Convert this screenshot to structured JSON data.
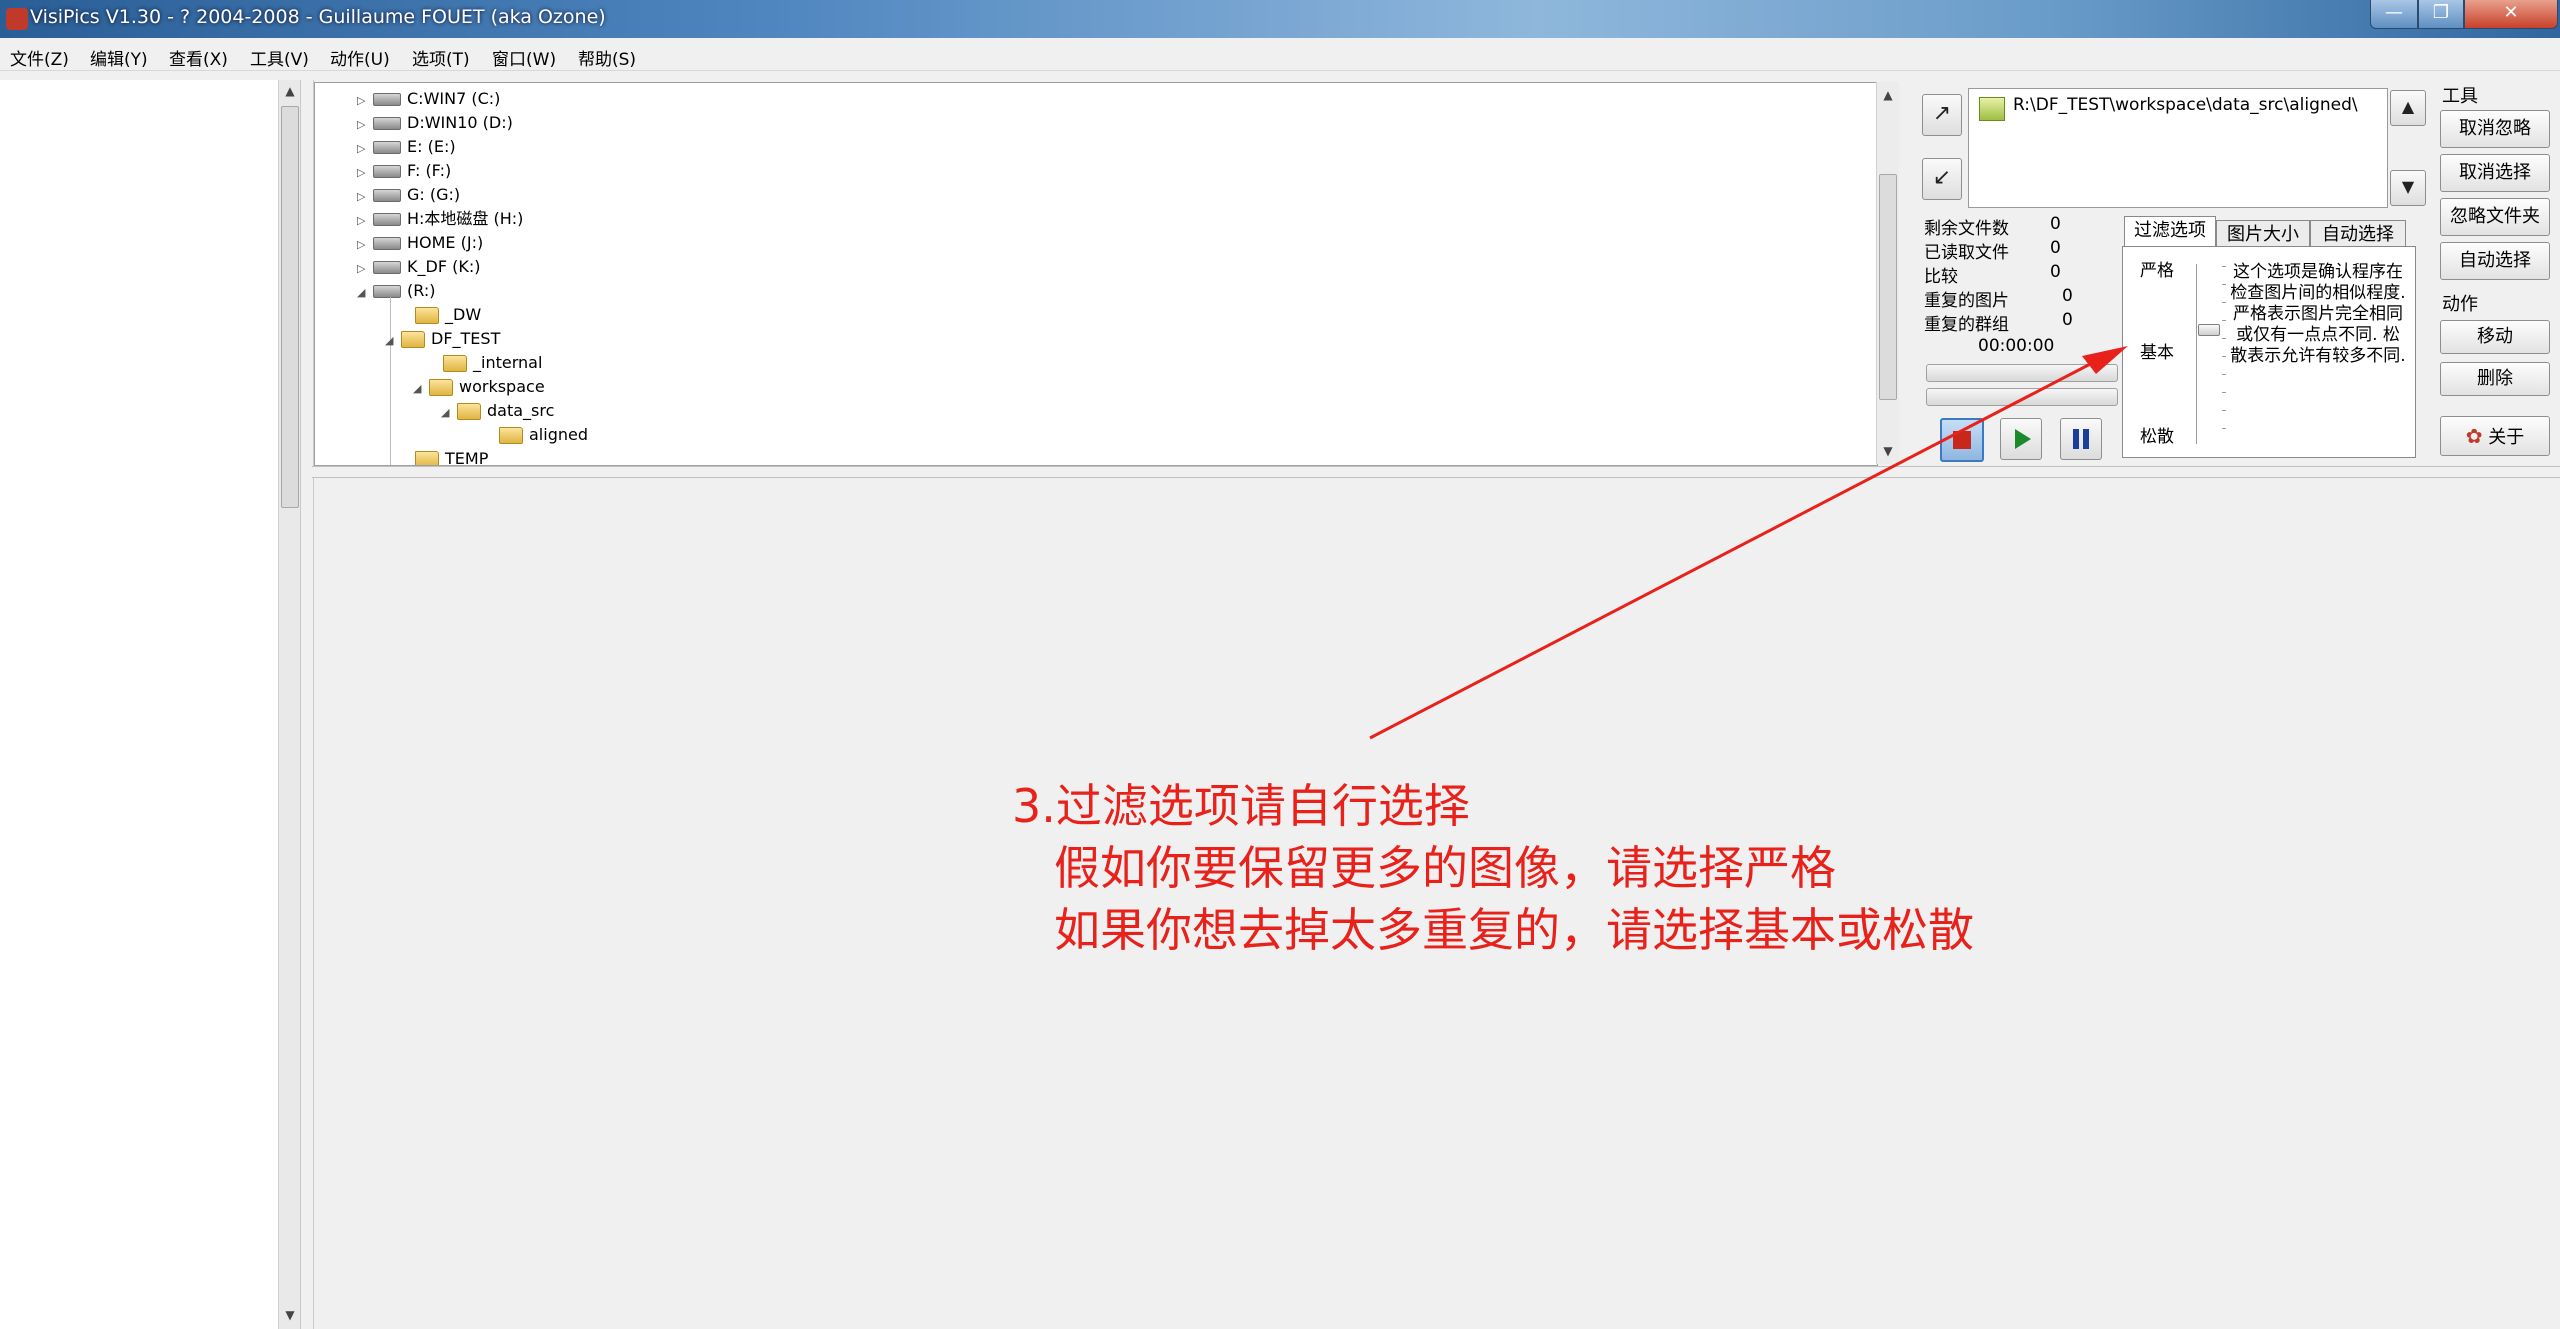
{
  "window": {
    "title": "VisiPics V1.30 - ? 2004-2008 - Guillaume FOUET (aka Ozone)",
    "minimize": "—",
    "maximize": "❐",
    "close": "✕"
  },
  "menu": [
    "文件(Z)",
    "编辑(Y)",
    "查看(X)",
    "工具(V)",
    "动作(U)",
    "选项(T)",
    "窗口(W)",
    "帮助(S)"
  ],
  "tree": {
    "drives": [
      "C:WIN7 (C:)",
      "D:WIN10 (D:)",
      "E: (E:)",
      "F: (F:)",
      "G: (G:)",
      "H:本地磁盘 (H:)",
      "HOME (J:)",
      "K_DF (K:)",
      "(R:)"
    ],
    "folders": [
      "_DW",
      "DF_TEST",
      "_internal",
      "workspace",
      "data_src",
      "aligned",
      "TEMP"
    ]
  },
  "path": {
    "value": "R:\\DF_TEST\\workspace\\data_src\\aligned\\"
  },
  "stats": [
    {
      "label": "剩余文件数",
      "value": "0"
    },
    {
      "label": "已读取文件",
      "value": "0"
    },
    {
      "label": "比较",
      "value": "0"
    },
    {
      "label": "重复的图片",
      "value": "0"
    },
    {
      "label": "重复的群组",
      "value": "0"
    }
  ],
  "timer": "00:00:00",
  "tabs": [
    "过滤选项",
    "图片大小",
    "自动选择"
  ],
  "filter": {
    "levels": [
      "严格",
      "基本",
      "松散"
    ],
    "description": "这个选项是确认程序在检查图片间的相似程度. 严格表示图片完全相同或仅有一点点不同. 松散表示允许有较多不同."
  },
  "tools": {
    "group_label": "工具",
    "buttons": [
      "取消忽略",
      "取消选择",
      "忽略文件夹",
      "自动选择"
    ]
  },
  "actions": {
    "group_label": "动作",
    "buttons": [
      "移动",
      "删除"
    ]
  },
  "about": {
    "label": "关于"
  },
  "annotation": {
    "line1": "3.过滤选项请自行选择",
    "line2": "假如你要保留更多的图像，请选择严格",
    "line3": "如果你想去掉太多重复的，请选择基本或松散",
    "color": "#e8211b"
  }
}
